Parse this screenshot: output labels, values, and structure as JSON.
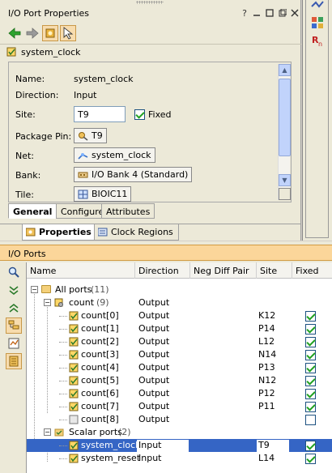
{
  "top_panel": {
    "title": "I/O Port Properties",
    "object_name": "system_clock",
    "properties": {
      "name_label": "Name:",
      "name_value": "system_clock",
      "direction_label": "Direction:",
      "direction_value": "Input",
      "site_label": "Site:",
      "site_value": "T9",
      "fixed_label": "Fixed",
      "package_pin_label": "Package Pin:",
      "package_pin_value": "T9",
      "net_label": "Net:",
      "net_value": "system_clock",
      "bank_label": "Bank:",
      "bank_value": "I/O Bank 4 (Standard)",
      "tile_label": "Tile:",
      "tile_value": "BIOIC11"
    },
    "sub_tabs": [
      "General",
      "Configure",
      "Attributes"
    ],
    "panel_tabs": [
      "Properties",
      "Clock Regions"
    ]
  },
  "io_ports": {
    "title": "I/O Ports",
    "columns": [
      "Name",
      "Direction",
      "Neg Diff Pair",
      "Site",
      "Fixed"
    ],
    "all_ports": {
      "label": "All ports",
      "count": "(11)"
    },
    "count_group": {
      "label": "count",
      "count": "(9)",
      "direction": "Output"
    },
    "count_rows": [
      {
        "name": "count[0]",
        "direction": "Output",
        "site": "K12",
        "fixed": true
      },
      {
        "name": "count[1]",
        "direction": "Output",
        "site": "P14",
        "fixed": true
      },
      {
        "name": "count[2]",
        "direction": "Output",
        "site": "L12",
        "fixed": true
      },
      {
        "name": "count[3]",
        "direction": "Output",
        "site": "N14",
        "fixed": true
      },
      {
        "name": "count[4]",
        "direction": "Output",
        "site": "P13",
        "fixed": true
      },
      {
        "name": "count[5]",
        "direction": "Output",
        "site": "N12",
        "fixed": true
      },
      {
        "name": "count[6]",
        "direction": "Output",
        "site": "P12",
        "fixed": true
      },
      {
        "name": "count[7]",
        "direction": "Output",
        "site": "P11",
        "fixed": true
      },
      {
        "name": "count[8]",
        "direction": "Output",
        "site": "",
        "fixed": false
      }
    ],
    "scalar_group": {
      "label": "Scalar ports",
      "count": "(2)"
    },
    "scalar_rows": [
      {
        "name": "system_clock",
        "direction": "Input",
        "site": "T9",
        "fixed": true,
        "selected": true
      },
      {
        "name": "system_reset",
        "direction": "Input",
        "site": "L14",
        "fixed": true,
        "selected": false
      }
    ]
  },
  "colors": {
    "accent_header": "#fbd69a",
    "selection": "#3565c5",
    "check": "#21a121"
  },
  "icons": [
    "back-arrow-icon",
    "forward-arrow-icon",
    "chip-icon",
    "cursor-icon",
    "search-icon"
  ]
}
